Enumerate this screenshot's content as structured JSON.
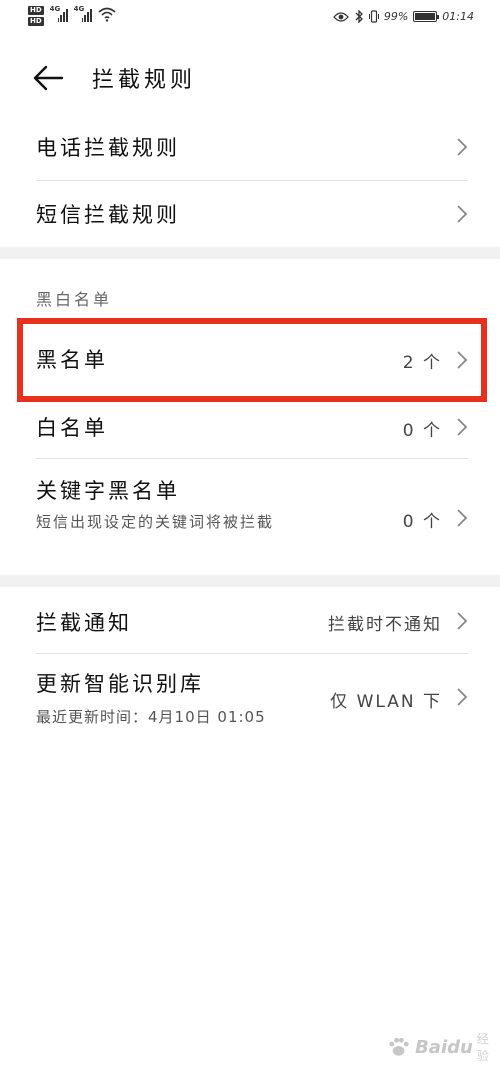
{
  "status_bar": {
    "hd1": "HD",
    "hd2": "HD",
    "net1": "4G",
    "net2": "4G",
    "battery_pct": "99%",
    "time": "01:14",
    "battery_level": 0.99
  },
  "header": {
    "title": "拦截规则"
  },
  "rules": {
    "items": [
      {
        "label": "电话拦截规则"
      },
      {
        "label": "短信拦截规则"
      }
    ]
  },
  "blackwhite": {
    "section_title": "黑白名单",
    "blacklist": {
      "label": "黑名单",
      "value": "2 个"
    },
    "whitelist": {
      "label": "白名单",
      "value": "0 个"
    },
    "keyword": {
      "label": "关键字黑名单",
      "sub": "短信出现设定的关键词将被拦截",
      "value": "0 个"
    }
  },
  "notify": {
    "intercept_notice": {
      "label": "拦截通知",
      "value": "拦截时不通知"
    },
    "update_lib": {
      "label": "更新智能识别库",
      "sub": "最近更新时间：4月10日 01:05",
      "value": "仅 WLAN 下"
    }
  },
  "watermark": {
    "brand": "Baidu",
    "suffix": "经验"
  },
  "colors": {
    "highlight": "#e8301f",
    "band": "#f1f1f1",
    "divider": "#e2e2e2"
  }
}
